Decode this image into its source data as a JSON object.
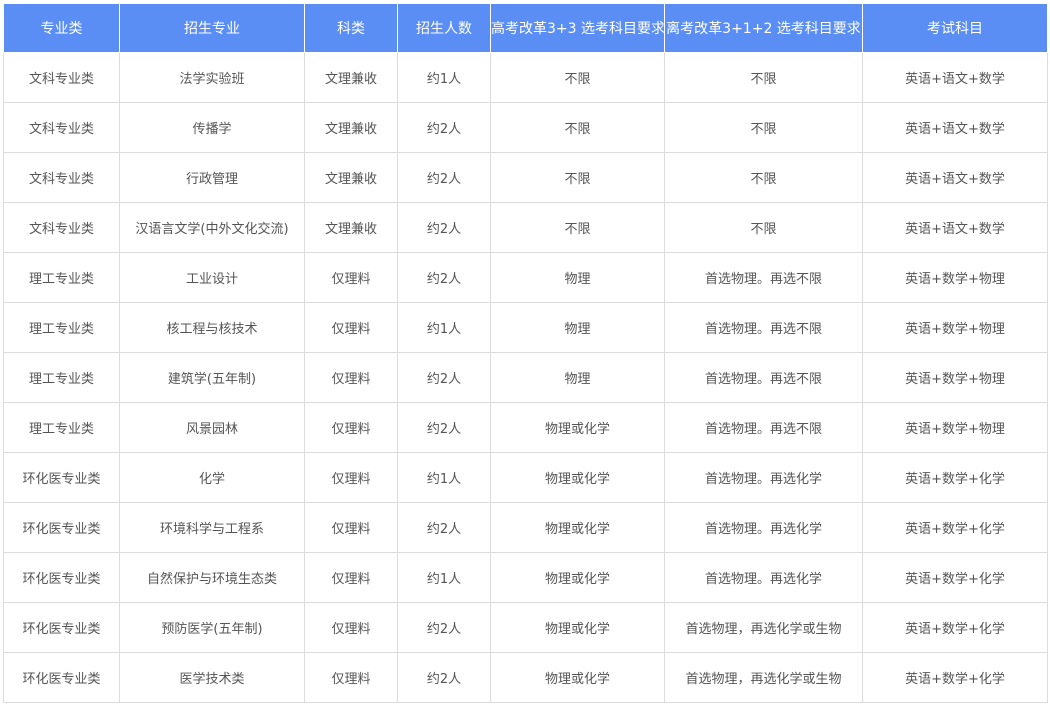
{
  "table": {
    "headers": [
      "专业类",
      "招生专业",
      "科类",
      "招生人数",
      "高考改革3+3 选考科目要求",
      "离考改革3+1+2 选考科目要求",
      "考试科目"
    ],
    "rows": [
      [
        "文科专业类",
        "法学实验班",
        "文理兼收",
        "约1人",
        "不限",
        "不限",
        "英语+语文+数学"
      ],
      [
        "文科专业类",
        "传播学",
        "文理兼收",
        "约2人",
        "不限",
        "不限",
        "英语+语文+数学"
      ],
      [
        "文科专业类",
        "行政管理",
        "文理兼收",
        "约2人",
        "不限",
        "不限",
        "英语+语文+数学"
      ],
      [
        "文科专业类",
        "汉语言文学(中外文化交流)",
        "文理兼收",
        "约2人",
        "不限",
        "不限",
        "英语+语文+数学"
      ],
      [
        "理工专业类",
        "工业设计",
        "仅理料",
        "约2人",
        "物理",
        "首选物理。再选不限",
        "英语+数学+物理"
      ],
      [
        "理工专业类",
        "核工程与核技术",
        "仅理料",
        "约1人",
        "物理",
        "首选物理。再选不限",
        "英语+数学+物理"
      ],
      [
        "理工专业类",
        "建筑学(五年制)",
        "仅理料",
        "约2人",
        "物理",
        "首选物理。再选不限",
        "英语+数学+物理"
      ],
      [
        "理工专业类",
        "风景园林",
        "仅理料",
        "约2人",
        "物理或化学",
        "首选物理。再选不限",
        "英语+数学+物理"
      ],
      [
        "环化医专业类",
        "化学",
        "仅理料",
        "约1人",
        "物理或化学",
        "首选物理。再选化学",
        "英语+数学+化学"
      ],
      [
        "环化医专业类",
        "环境科学与工程系",
        "仅理料",
        "约2人",
        "物理或化学",
        "首选物理。再选化学",
        "英语+数学+化学"
      ],
      [
        "环化医专业类",
        "自然保护与环境生态类",
        "仅理料",
        "约1人",
        "物理或化学",
        "首选物理。再选化学",
        "英语+数学+化学"
      ],
      [
        "环化医专业类",
        "预防医学(五年制)",
        "仅理料",
        "约2人",
        "物理或化学",
        "首选物理，再选化学或生物",
        "英语+数学+化学"
      ],
      [
        "环化医专业类",
        "医学技术类",
        "仅理料",
        "约2人",
        "物理或化学",
        "首选物理，再选化学或生物",
        "英语+数学+化学"
      ]
    ]
  },
  "colors": {
    "header_bg": "#5b8ef5",
    "header_text": "#ffffff",
    "cell_text": "#555555",
    "border": "#dcdcdc"
  }
}
